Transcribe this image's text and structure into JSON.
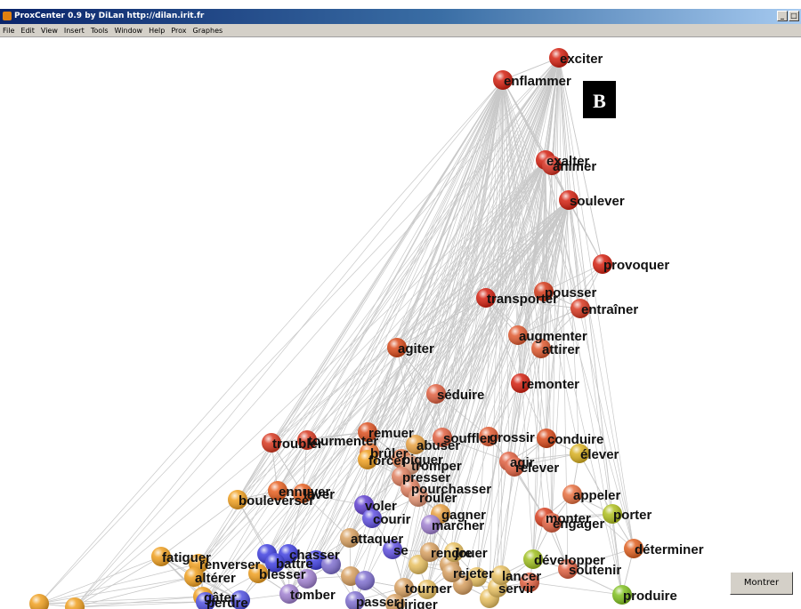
{
  "window": {
    "title": "ProxCenter 0.9 by DiLan http://dilan.irit.fr"
  },
  "menu": [
    "File",
    "Edit",
    "View",
    "Insert",
    "Tools",
    "Window",
    "Help",
    "Prox",
    "Graphes"
  ],
  "panel_label": "B",
  "show_button": "Montrer",
  "graph": {
    "edge_color": "#c8c8c8",
    "nodes": [
      {
        "label": "exciter",
        "color": "#d42010"
      },
      {
        "label": "enflammer",
        "color": "#d42010"
      },
      {
        "label": "exalter",
        "color": "#d42010"
      },
      {
        "label": "animer",
        "color": "#d63020"
      },
      {
        "label": "soulever",
        "color": "#d42010"
      },
      {
        "label": "provoquer",
        "color": "#d42010"
      },
      {
        "label": "pousser",
        "color": "#d43818"
      },
      {
        "label": "transporter",
        "color": "#d42010"
      },
      {
        "label": "entraîner",
        "color": "#d83820"
      },
      {
        "label": "augmenter",
        "color": "#e05a30"
      },
      {
        "label": "attirer",
        "color": "#e05a30"
      },
      {
        "label": "agiter",
        "color": "#d84818"
      },
      {
        "label": "remonter",
        "color": "#d42010"
      },
      {
        "label": "séduire",
        "color": "#e06040"
      },
      {
        "label": "troubler",
        "color": "#d83820"
      },
      {
        "label": "tourmenter",
        "color": "#d83820"
      },
      {
        "label": "remuer",
        "color": "#dc5020"
      },
      {
        "label": "abuser",
        "color": "#e8a040"
      },
      {
        "label": "souffler",
        "color": "#e06040"
      },
      {
        "label": "grossir",
        "color": "#e05a30"
      },
      {
        "label": "conduire",
        "color": "#d84818"
      },
      {
        "label": "élever",
        "color": "#d8b020"
      },
      {
        "label": "brûler",
        "color": "#e87030"
      },
      {
        "label": "forcer",
        "color": "#f0a020"
      },
      {
        "label": "piquer",
        "color": "#e88050"
      },
      {
        "label": "tromper",
        "color": "#e0a080"
      },
      {
        "label": "agir",
        "color": "#e06040"
      },
      {
        "label": "relever",
        "color": "#e06040"
      },
      {
        "label": "presser",
        "color": "#e08060"
      },
      {
        "label": "pourchasser",
        "color": "#e08060"
      },
      {
        "label": "rouler",
        "color": "#e09070"
      },
      {
        "label": "appeler",
        "color": "#e87040"
      },
      {
        "label": "ennuyer",
        "color": "#e86020"
      },
      {
        "label": "laver",
        "color": "#e86020"
      },
      {
        "label": "bouleverser",
        "color": "#f0a020"
      },
      {
        "label": "voler",
        "color": "#6040d0"
      },
      {
        "label": "courir",
        "color": "#6050e0"
      },
      {
        "label": "gagner",
        "color": "#e8a040"
      },
      {
        "label": "marcher",
        "color": "#a080d0"
      },
      {
        "label": "monter",
        "color": "#d84020"
      },
      {
        "label": "engager",
        "color": "#e06040"
      },
      {
        "label": "porter",
        "color": "#b0c020"
      },
      {
        "label": "attaquer",
        "color": "#d8a060"
      },
      {
        "label": "jouer",
        "color": "#e8c060"
      },
      {
        "label": "déterminer",
        "color": "#e06020"
      },
      {
        "label": "fatiguer",
        "color": "#f0a020"
      },
      {
        "label": "renverser",
        "color": "#f0a020"
      },
      {
        "label": "chasser",
        "color": "#4040e0"
      },
      {
        "label": "altérer",
        "color": "#f0a020"
      },
      {
        "label": "blesser",
        "color": "#f0a020"
      },
      {
        "label": "développer",
        "color": "#a0c020"
      },
      {
        "label": "soutenir",
        "color": "#e06040"
      },
      {
        "label": "tomber",
        "color": "#a080d0"
      },
      {
        "label": "rejeter",
        "color": "#d8a060"
      },
      {
        "label": "tourner",
        "color": "#d8a060"
      },
      {
        "label": "servir",
        "color": "#e8c060"
      },
      {
        "label": "produire",
        "color": "#80c020"
      },
      {
        "label": "gâter",
        "color": "#f0a020"
      },
      {
        "label": "perdre",
        "color": "#5050e0"
      },
      {
        "label": "passer",
        "color": "#8070d0"
      },
      {
        "label": "diriger",
        "color": "#d8a060"
      },
      {
        "label": "se",
        "color": "#6050e0"
      },
      {
        "label": "rendre",
        "color": "#d8a060"
      },
      {
        "label": "battre",
        "color": "#4040e0"
      },
      {
        "label": "lancer",
        "color": "#e8c060"
      }
    ]
  }
}
